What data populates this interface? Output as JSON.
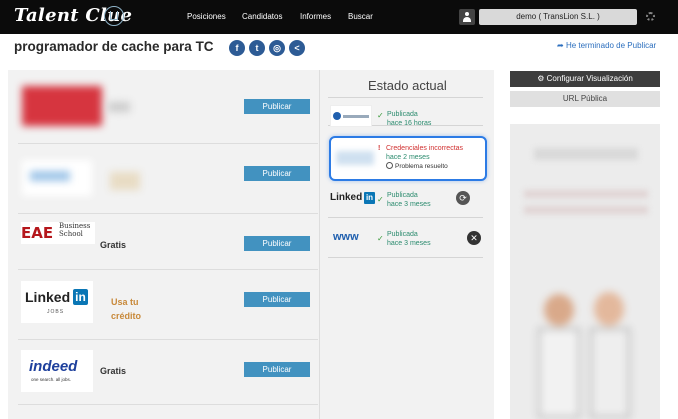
{
  "topbar": {
    "logo": "Talent Clue",
    "nav": [
      "Posiciones",
      "Candidatos",
      "Informes",
      "Buscar"
    ],
    "user": "demo ( TransLion S.L. )"
  },
  "page": {
    "title": "programador de cache para TC",
    "finish_link": "He terminado de Publicar"
  },
  "job_boards": [
    {
      "label": "",
      "button": "Publicar"
    },
    {
      "label": "",
      "button": "Publicar"
    },
    {
      "logo": "EAE Business School",
      "label": "Gratis",
      "button": "Publicar"
    },
    {
      "logo": "Linked in",
      "logo_sub": "JOBS",
      "label_line1": "Usa tu",
      "label_line2": "crédito",
      "button": "Publicar"
    },
    {
      "logo": "indeed",
      "logo_sub": "one search. all jobs.",
      "label": "Gratis",
      "button": "Publicar"
    }
  ],
  "status": {
    "title": "Estado actual",
    "items": [
      {
        "line1": "Publicada",
        "line2": "hace 16 horas"
      },
      {
        "line1": "Credenciales incorrectas",
        "line2": "hace 2 meses",
        "resolved": "Problema resuelto"
      },
      {
        "logo": "Linked in",
        "line1": "Publicada",
        "line2": "hace 3 meses"
      },
      {
        "logo": "www",
        "line1": "Publicada",
        "line2": "hace 3 meses"
      }
    ]
  },
  "right": {
    "config_button": "Configurar Visualización",
    "url_button": "URL Pública"
  },
  "colors": {
    "accent": "#4292c0",
    "topbar": "#0b0b0b",
    "highlight_border": "#2c7be5"
  }
}
